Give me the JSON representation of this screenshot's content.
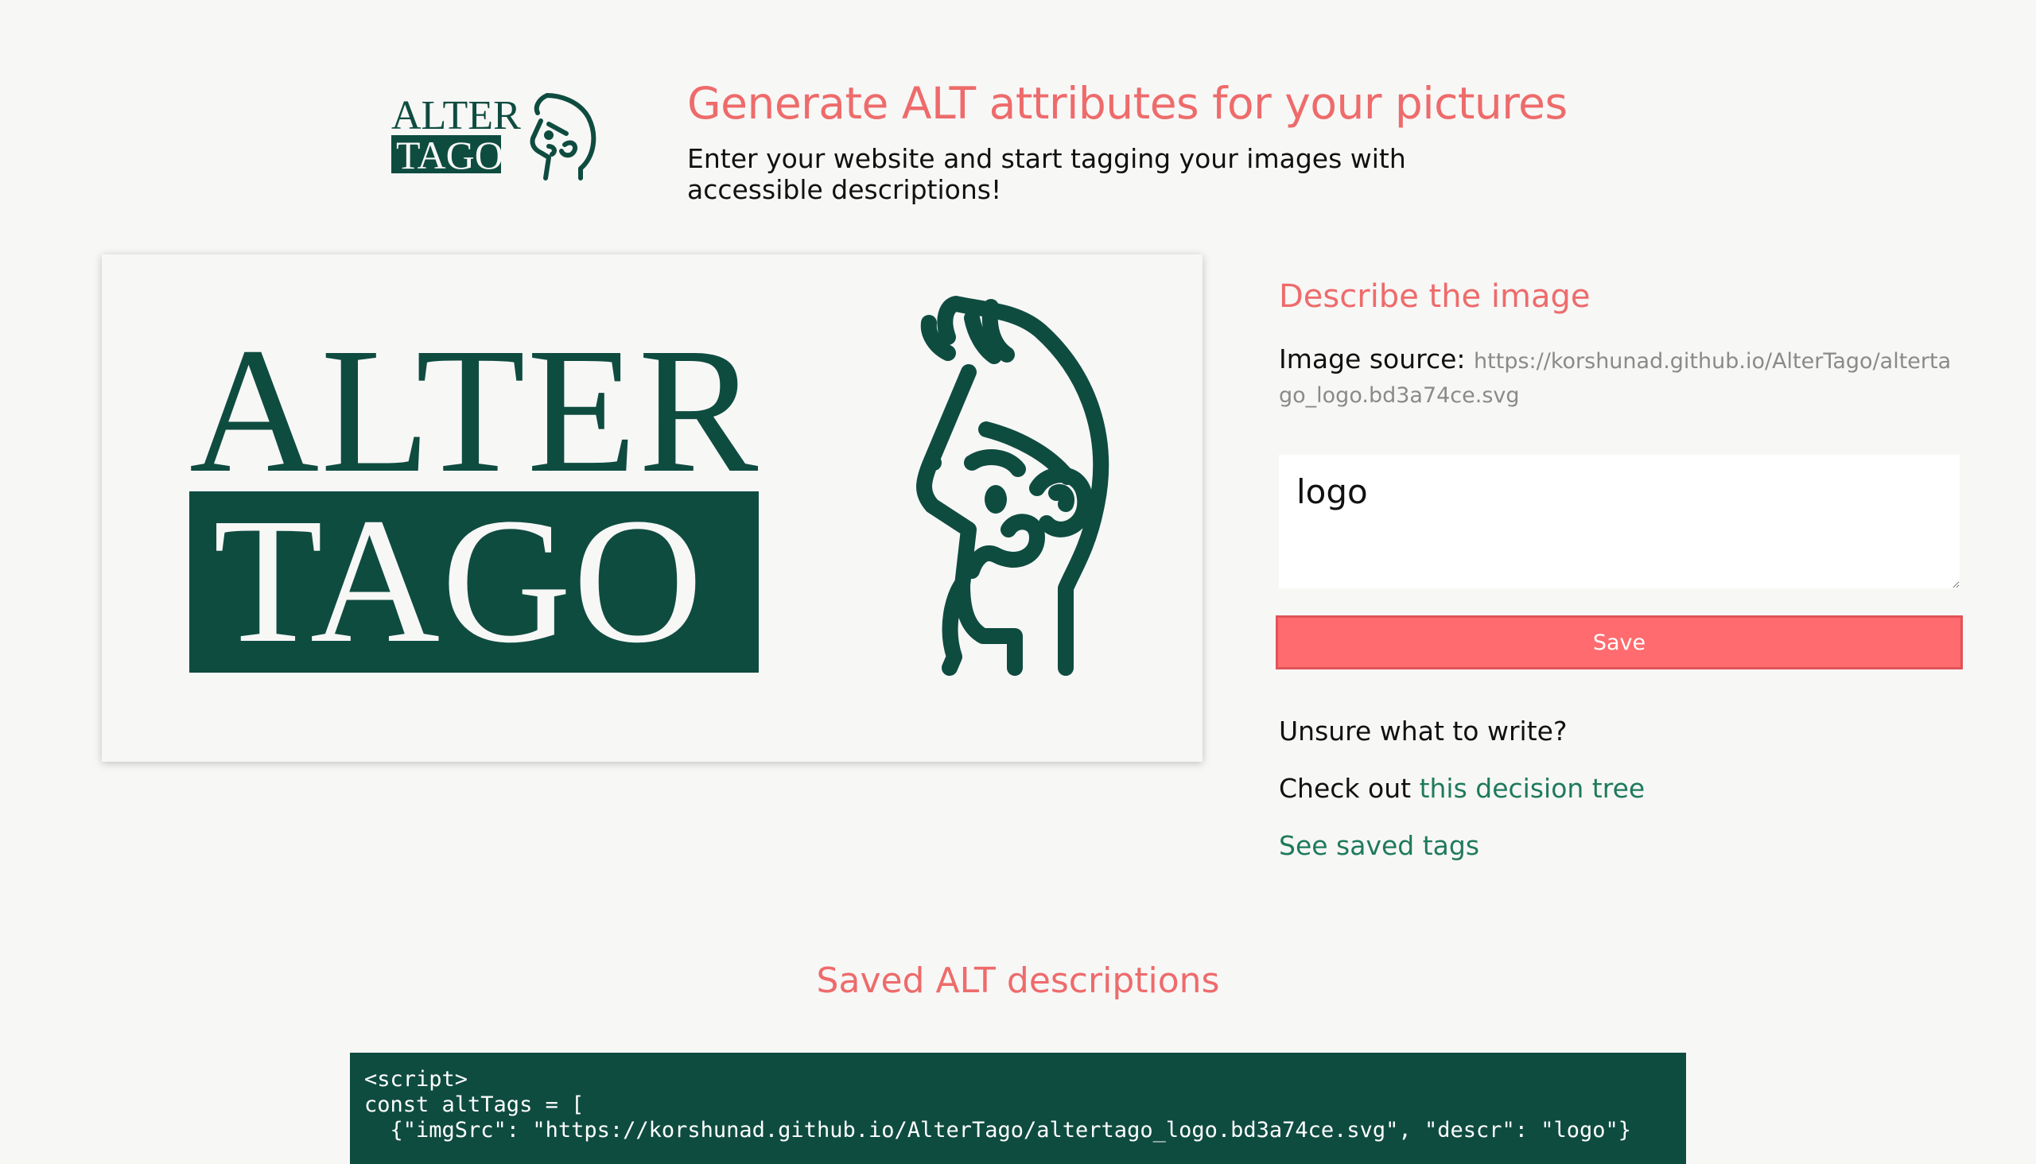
{
  "brand": {
    "logo_line1": "ALTER",
    "logo_line2": "TAGO",
    "color": "#0f4c40"
  },
  "header": {
    "title": "Generate ALT attributes for your pictures",
    "subtitle": "Enter your website and start tagging your images with accessible descriptions!"
  },
  "preview": {
    "logo_line1": "ALTER",
    "logo_line2": "TAGO"
  },
  "panel": {
    "heading": "Describe the image",
    "source_label": "Image source:",
    "source_url": "https://korshunad.github.io/AlterTago/altertago_logo.bd3a74ce.svg",
    "description_value": "logo",
    "save_label": "Save",
    "unsure_text": "Unsure what to write?",
    "check_out_text": "Check out",
    "decision_tree_link": "this decision tree",
    "saved_tags_link": "See saved tags"
  },
  "saved": {
    "heading": "Saved ALT descriptions",
    "code_lines": [
      "<script>",
      "const altTags = [",
      "  {\"imgSrc\": \"https://korshunad.github.io/AlterTago/altertago_logo.bd3a74ce.svg\", \"descr\": \"logo\"}"
    ]
  },
  "colors": {
    "accent": "#ee6b6b",
    "button": "#ff6b6e",
    "link": "#1f7a5c",
    "brand_green": "#0f4c40",
    "background": "#f7f7f6"
  }
}
